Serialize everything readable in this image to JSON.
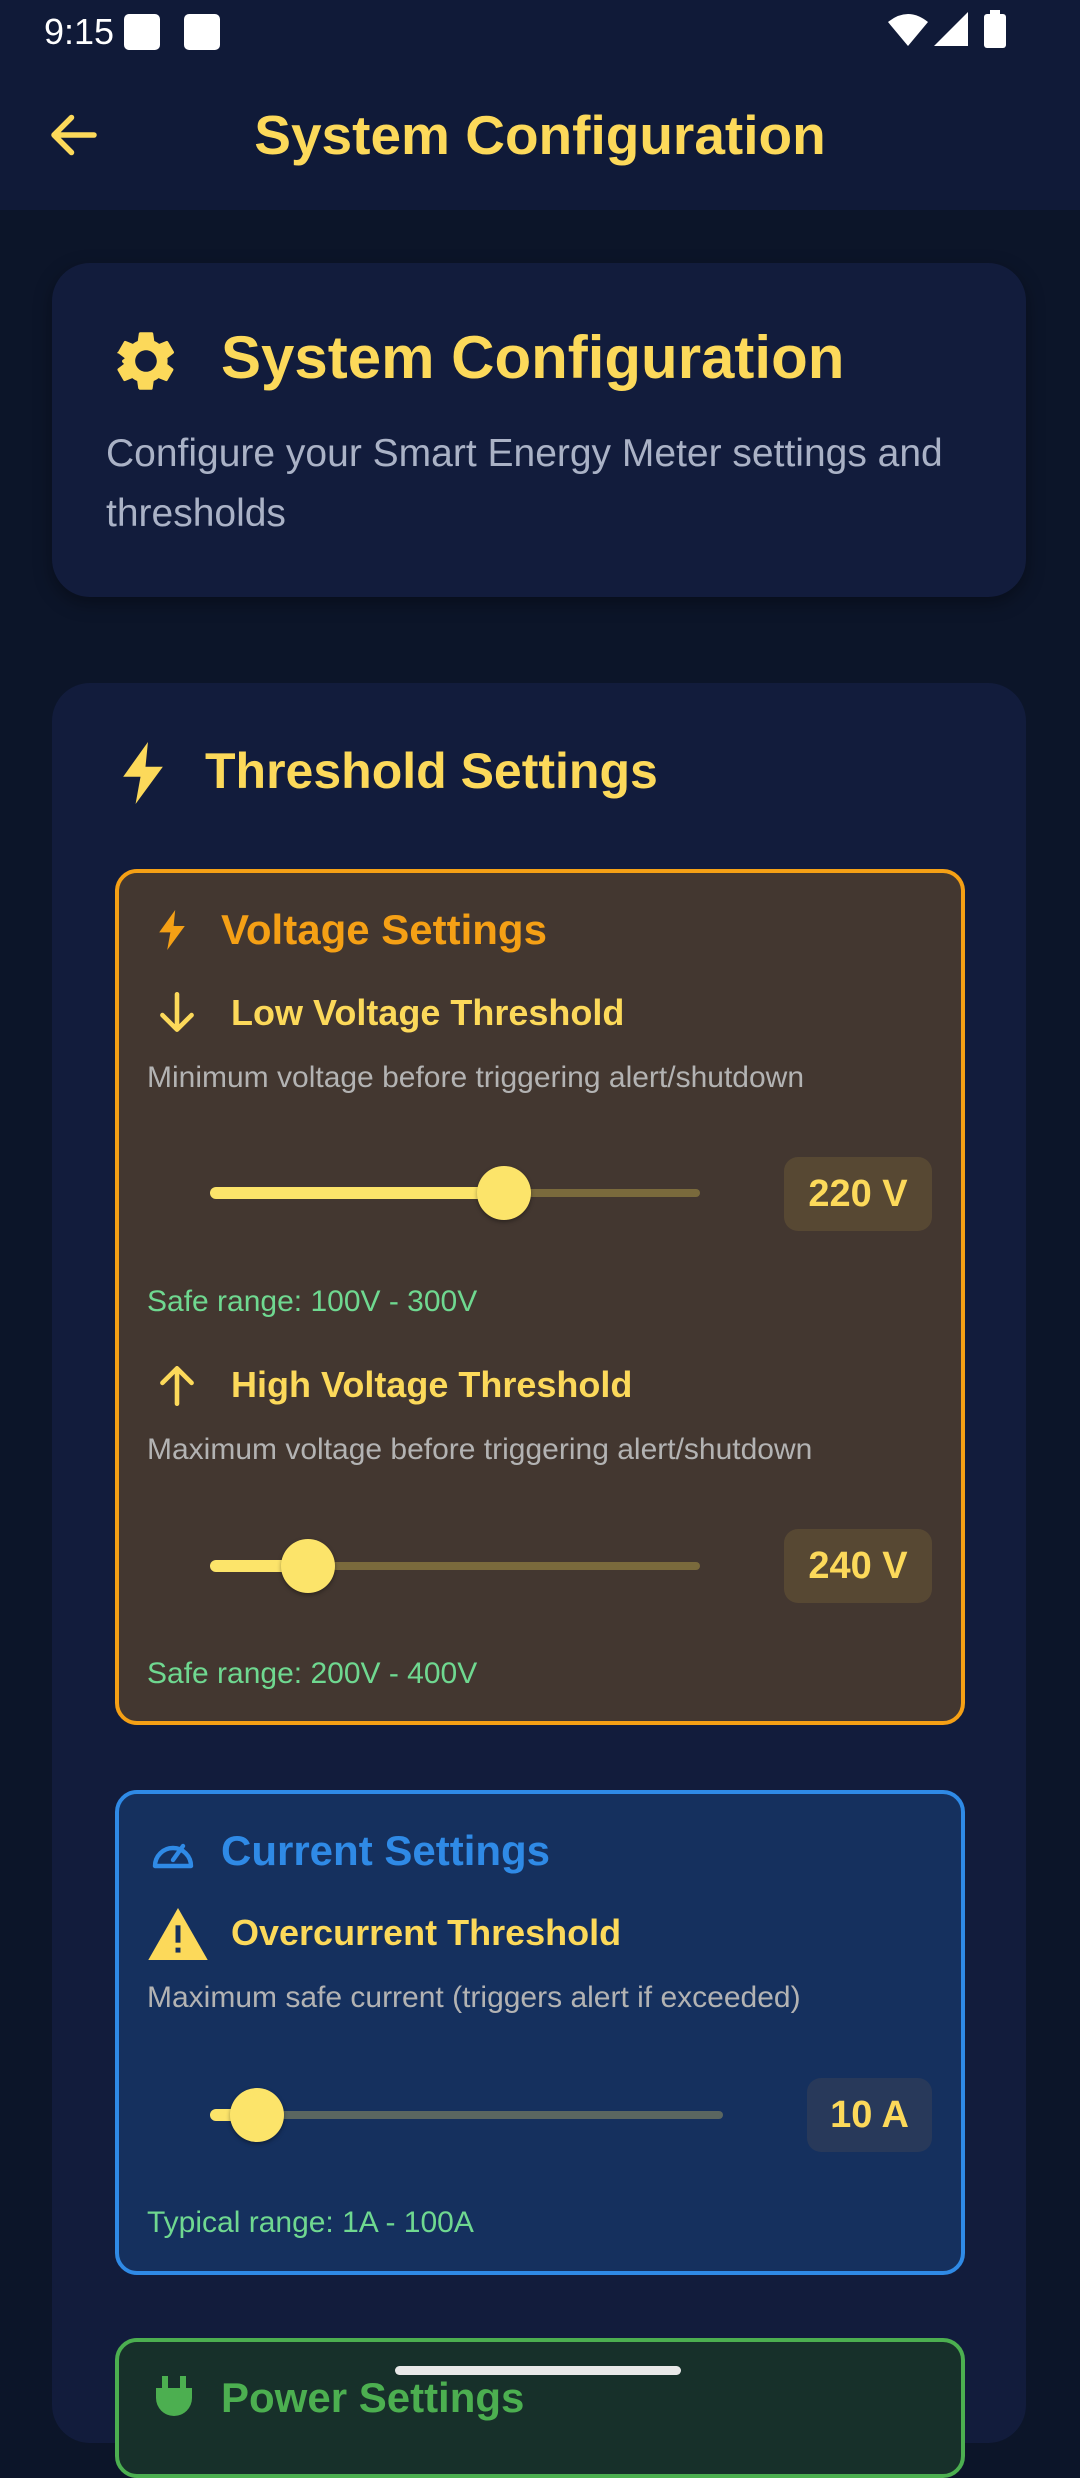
{
  "status_bar": {
    "time": "9:15"
  },
  "app_bar": {
    "title": "System Configuration"
  },
  "header_card": {
    "title": "System Configuration",
    "description": "Configure your Smart Energy Meter settings and thresholds"
  },
  "threshold_settings": {
    "title": "Threshold Settings",
    "voltage": {
      "title": "Voltage Settings",
      "low": {
        "title": "Low Voltage Threshold",
        "description": "Minimum voltage before triggering alert/shutdown",
        "value_label": "220 V",
        "value": 220,
        "min": 100,
        "max": 300,
        "range_text": "Safe range: 100V - 300V"
      },
      "high": {
        "title": "High Voltage Threshold",
        "description": "Maximum voltage before triggering alert/shutdown",
        "value_label": "240 V",
        "value": 240,
        "min": 200,
        "max": 400,
        "range_text": "Safe range: 200V - 400V"
      }
    },
    "current": {
      "title": "Current Settings",
      "overcurrent": {
        "title": "Overcurrent Threshold",
        "description": "Maximum safe current (triggers alert if exceeded)",
        "value_label": "10 A",
        "value": 10,
        "min": 1,
        "max": 100,
        "range_text": "Typical range: 1A - 100A"
      }
    },
    "power": {
      "title": "Power Settings"
    }
  },
  "colors": {
    "background": "#0c1529",
    "app_bar": "#101a38",
    "accent_yellow": "#fcd95a",
    "voltage_orange": "#f5a015",
    "current_blue": "#2f8ae6",
    "power_green": "#4caf50",
    "range_green": "#6fd890"
  },
  "icons": [
    "back-arrow-icon",
    "gear-icon",
    "bolt-icon",
    "arrow-down-icon",
    "arrow-up-icon",
    "speedometer-icon",
    "warning-icon",
    "plug-icon"
  ]
}
